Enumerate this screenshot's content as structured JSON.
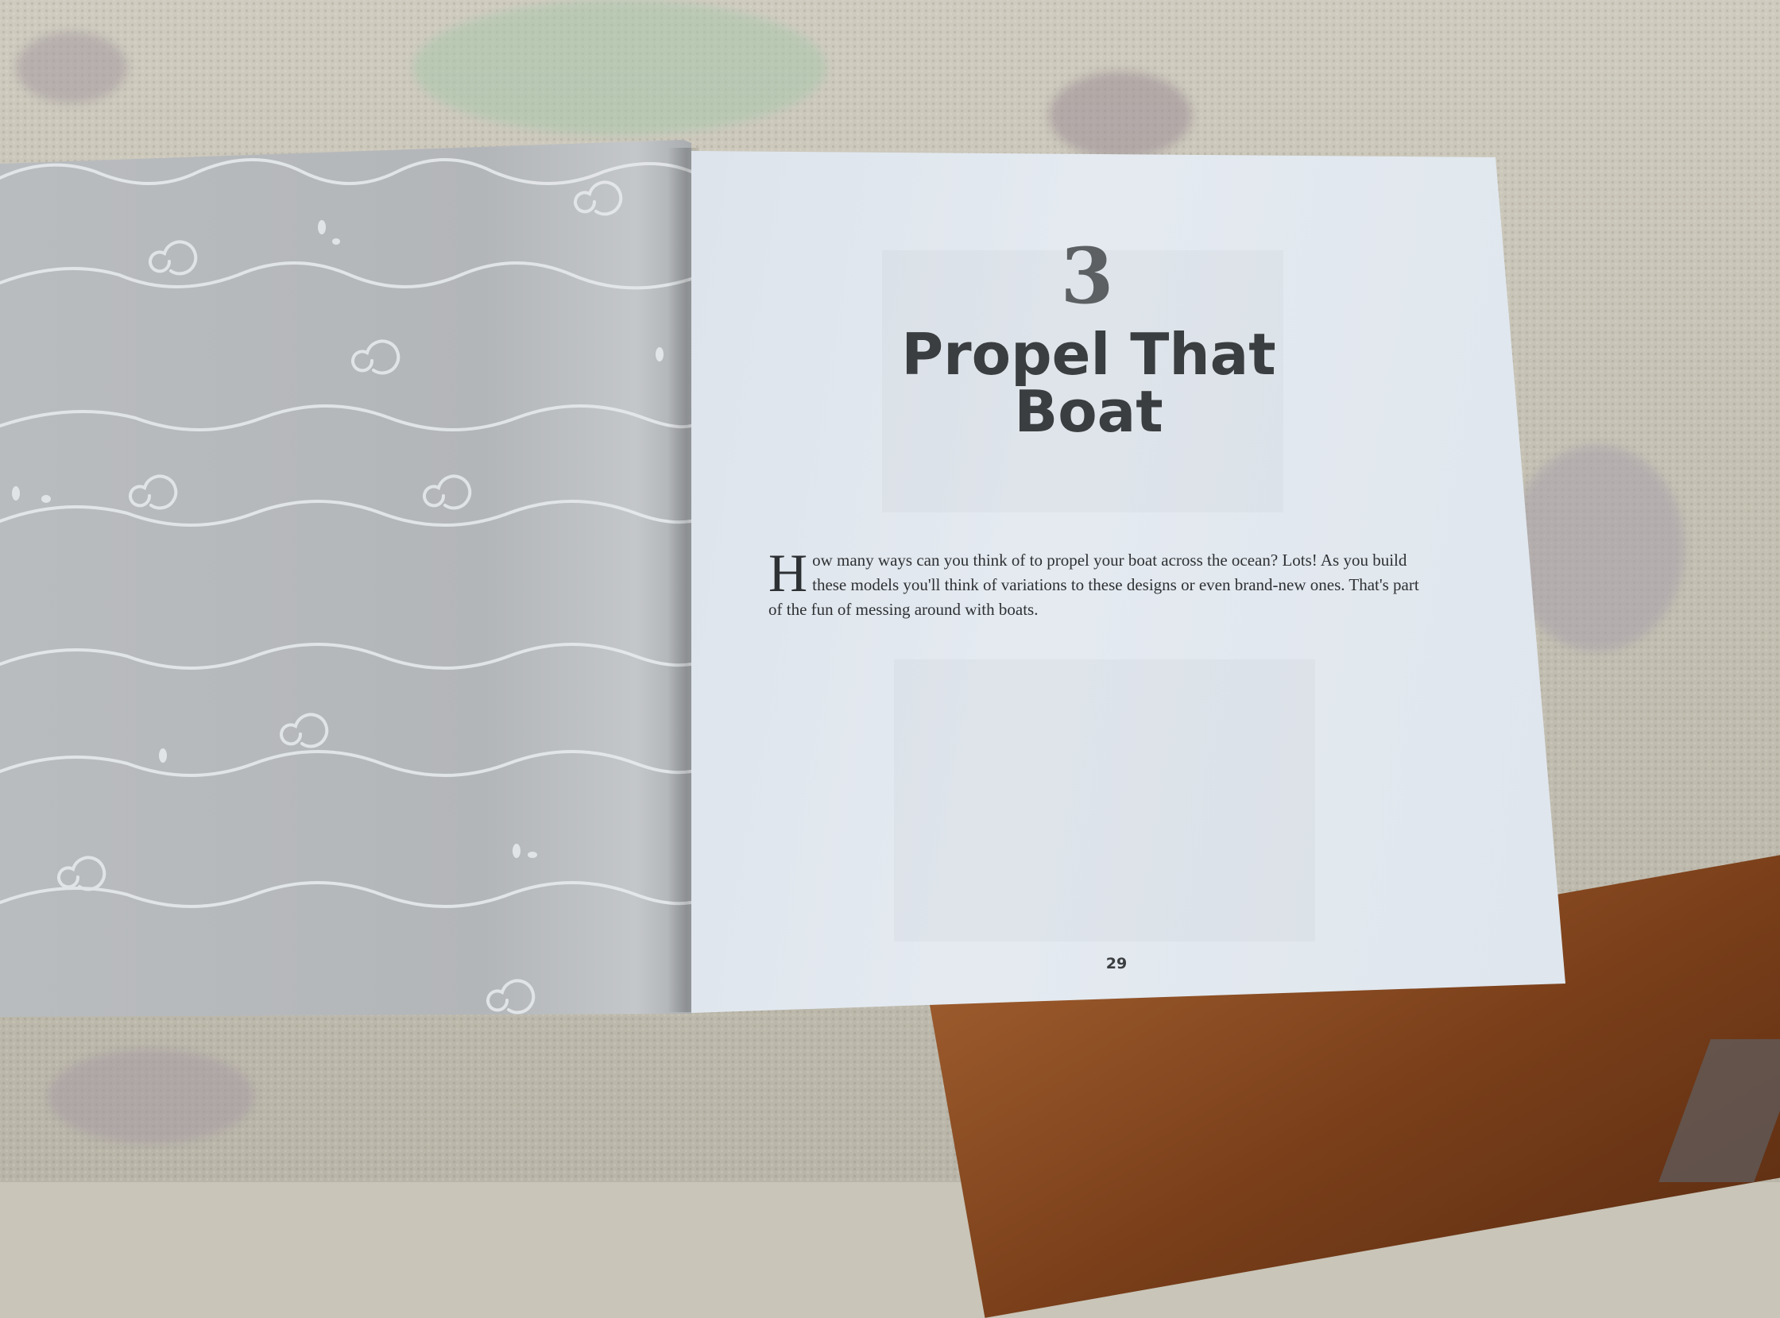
{
  "chapter": {
    "number": "3",
    "title": "Propel That Boat"
  },
  "intro": {
    "drop_cap": "H",
    "text": "ow many ways can you think of to propel your boat across the ocean? Lots! As you build these models you'll think of variations to these designs or even brand-new ones. That's part of the fun of messing around with boats."
  },
  "page_number": "29",
  "colors": {
    "left_page": "#b6b9bc",
    "right_page": "#e2e8ee",
    "wave_line": "#e9ecee",
    "title_text": "#3b3e40",
    "rug": "#c9c5b8",
    "floor": "#7a3f1a"
  }
}
